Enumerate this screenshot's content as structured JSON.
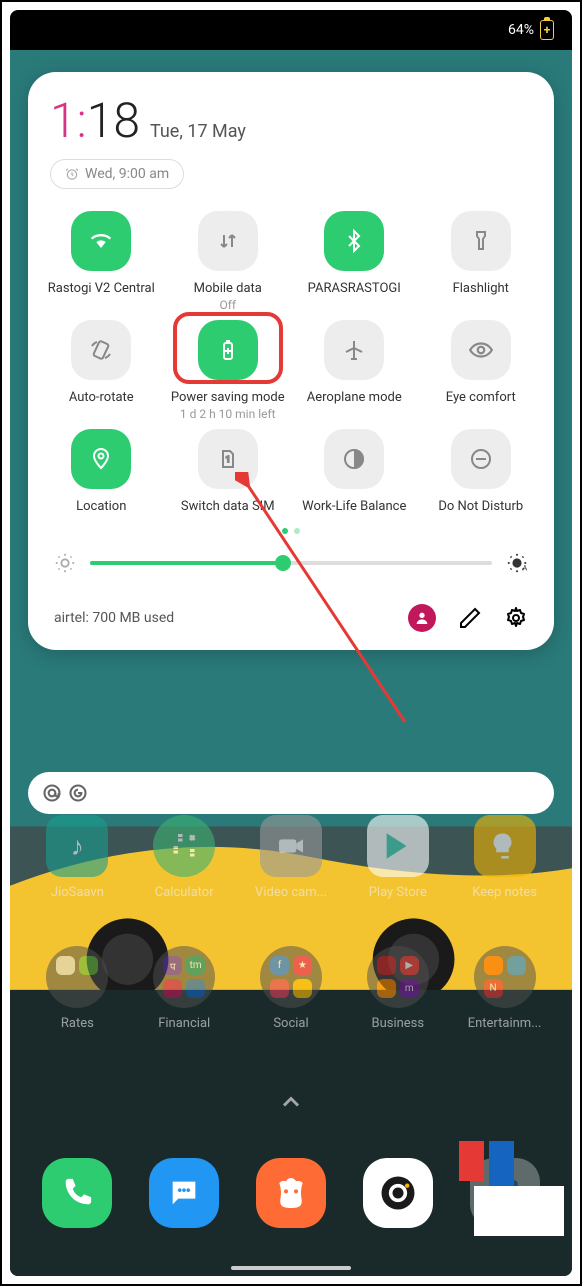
{
  "statusbar": {
    "battery_pct": "64%"
  },
  "panel": {
    "time_hour": "1",
    "time_sep": ":",
    "time_min": "18",
    "date": "Tue, 17 May",
    "alarm": "Wed, 9:00 am"
  },
  "qs": {
    "row1": [
      {
        "name": "wifi",
        "label": "Rastogi V2 Central",
        "sublabel": "",
        "active": true
      },
      {
        "name": "mobile-data",
        "label": "Mobile data",
        "sublabel": "Off",
        "active": false
      },
      {
        "name": "bluetooth",
        "label": "PARASRASTOGI",
        "sublabel": "",
        "active": true
      },
      {
        "name": "flashlight",
        "label": "Flashlight",
        "sublabel": "",
        "active": false
      }
    ],
    "row2": [
      {
        "name": "auto-rotate",
        "label": "Auto-rotate",
        "sublabel": "",
        "active": false
      },
      {
        "name": "power-saving",
        "label": "Power saving mode",
        "sublabel": "1 d 2 h 10 min left",
        "active": true,
        "highlighted": true
      },
      {
        "name": "aeroplane",
        "label": "Aeroplane mode",
        "sublabel": "",
        "active": false
      },
      {
        "name": "eye-comfort",
        "label": "Eye comfort",
        "sublabel": "",
        "active": false
      }
    ],
    "row3": [
      {
        "name": "location",
        "label": "Location",
        "sublabel": "",
        "active": true
      },
      {
        "name": "switch-sim",
        "label": "Switch data SIM",
        "sublabel": "",
        "active": false
      },
      {
        "name": "work-life",
        "label": "Work-Life Balance",
        "sublabel": "",
        "active": false
      },
      {
        "name": "dnd",
        "label": "Do Not Disturb",
        "sublabel": "",
        "active": false
      }
    ]
  },
  "data_usage": "airtel: 700 MB  used",
  "home_row1": [
    {
      "label": "JioSaavn"
    },
    {
      "label": "Calculator"
    },
    {
      "label": "Video cam..."
    },
    {
      "label": "Play Store"
    },
    {
      "label": "Keep notes"
    }
  ],
  "home_row2": [
    {
      "label": "Rates"
    },
    {
      "label": "Financial"
    },
    {
      "label": "Social"
    },
    {
      "label": "Business"
    },
    {
      "label": "Entertainm..."
    }
  ],
  "colors": {
    "accent_green": "#2ecc71",
    "accent_pink": "#d63384",
    "highlight_red": "#e53935",
    "user_badge": "#c2185b"
  }
}
